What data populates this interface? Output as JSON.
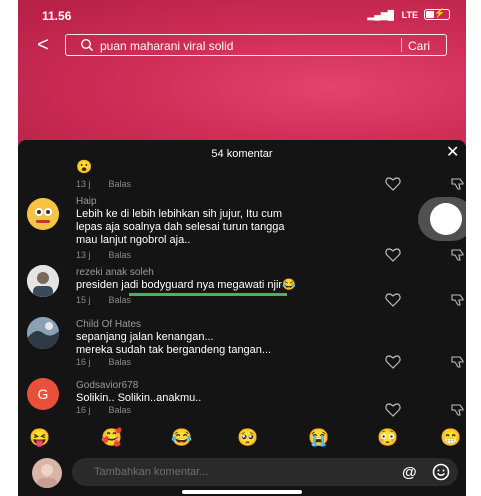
{
  "status_bar": {
    "time": "11.56",
    "network": "LTE",
    "signal_icon": "signal-bars-icon",
    "battery_icon": "battery-charging-icon"
  },
  "search": {
    "query": "puan maharani viral solid",
    "button": "Cari"
  },
  "comments_panel": {
    "title": "54 komentar"
  },
  "comments": [
    {
      "user": "",
      "text": "",
      "time": "13 j",
      "reply": "Balas",
      "emoji": "😮"
    },
    {
      "user": "Haip",
      "lines": [
        "Lebih ke di lebih lebihkan sih jujur, Itu cum",
        "lepas aja soalnya dah selesai turun tangga",
        "mau lanjut ngobrol aja.."
      ],
      "time": "13 j",
      "reply": "Balas"
    },
    {
      "user": "rezeki anak soleh",
      "lines": [
        "presiden jadi bodyguard nya megawati njir😂"
      ],
      "time": "15 j",
      "reply": "Balas"
    },
    {
      "user": "Child Of Hates",
      "lines": [
        "sepanjang jalan kenangan...",
        "mereka sudah tak bergandeng tangan..."
      ],
      "time": "16 j",
      "reply": "Balas"
    },
    {
      "user": "Godsavior678",
      "lines": [
        "Solikin.. Solikin..anakmu.."
      ],
      "time": "16 j",
      "reply": "Balas",
      "avatar_letter": "G"
    }
  ],
  "emoji_bar": [
    "😝",
    "🥰",
    "😂",
    "🥺",
    "😭",
    "😳",
    "😁"
  ],
  "composer": {
    "placeholder": "Tambahkan komentar...",
    "mention": "@"
  },
  "colors": {
    "accent": "#cf2e57",
    "sheet": "#141414",
    "underline": "#47b74b",
    "avatar_g": "#e8503a"
  }
}
